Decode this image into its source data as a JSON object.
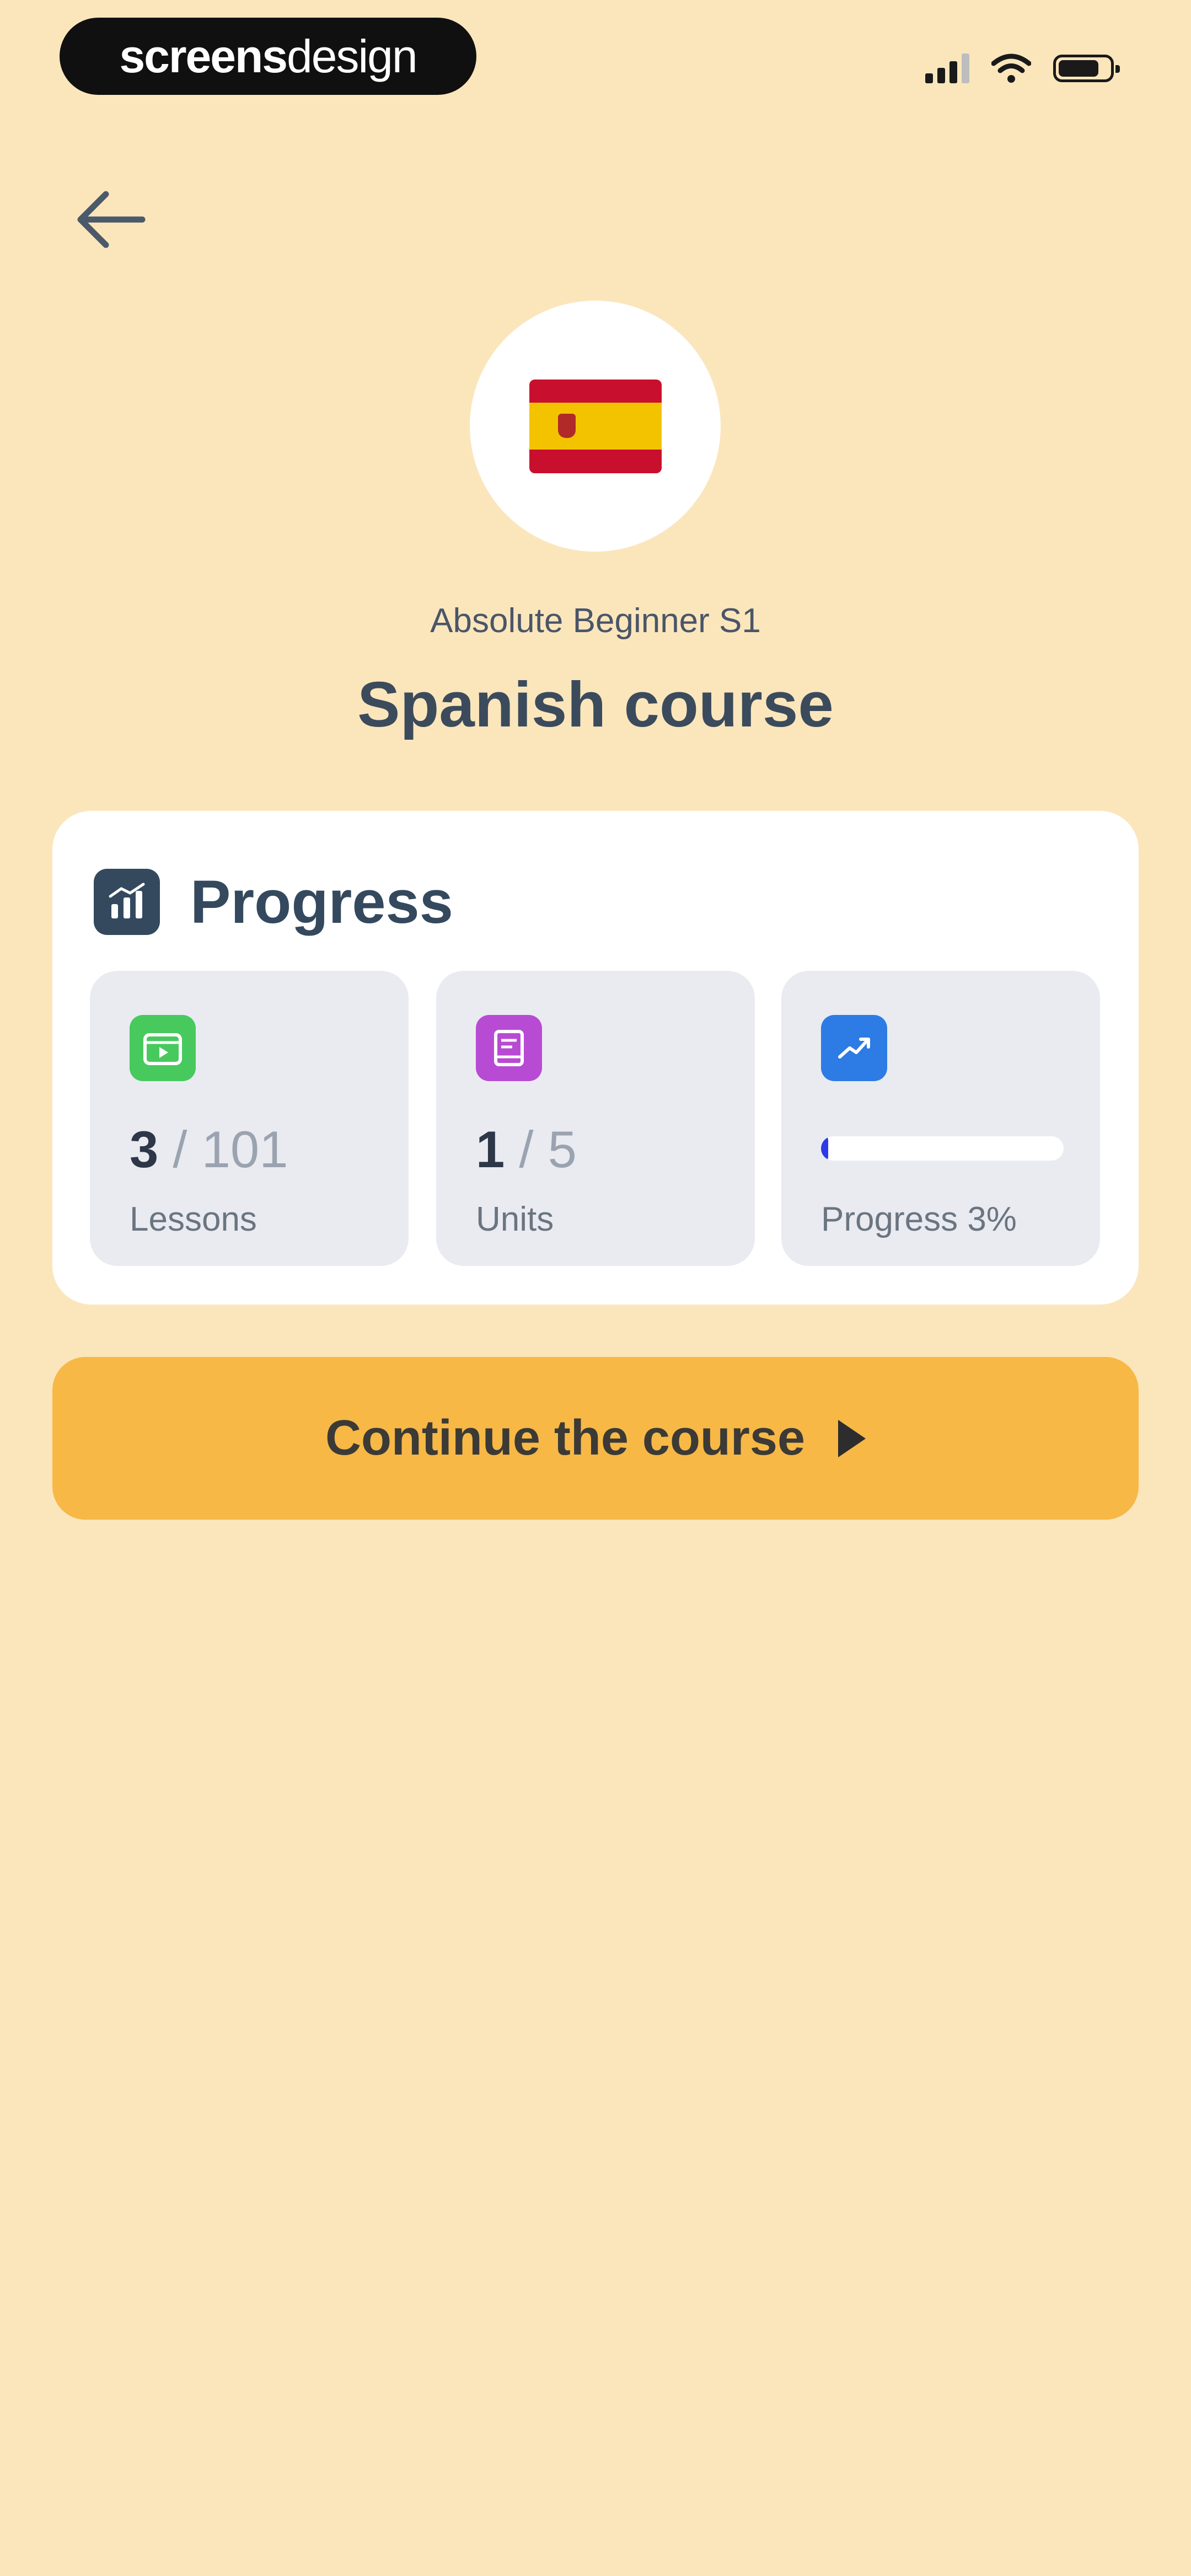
{
  "status_bar": {
    "brand": {
      "part1": "screens",
      "part2": "design"
    },
    "signal_icon": "cellular-signal-icon",
    "wifi_icon": "wifi-icon",
    "battery_icon": "battery-icon"
  },
  "header": {
    "back_icon": "arrow-left-icon"
  },
  "course": {
    "flag_icon": "spain-flag-icon",
    "level": "Absolute Beginner S1",
    "title": "Spanish course"
  },
  "progress_card": {
    "title": "Progress",
    "icon": "chart-icon",
    "stats": {
      "lessons": {
        "current": "3",
        "total": "/ 101",
        "label": "Lessons",
        "icon": "video-lesson-icon"
      },
      "units": {
        "current": "1",
        "total": "/ 5",
        "label": "Units",
        "icon": "book-icon"
      },
      "progress": {
        "label": "Progress 3%",
        "value": 0.03,
        "icon": "trend-up-icon"
      }
    }
  },
  "continue_button": {
    "label": "Continue the course",
    "icon": "play-icon"
  },
  "colors": {
    "background": "#FBE6BC",
    "accent": "#F7B846",
    "lessons_icon": "#48C95E",
    "units_icon": "#B84BD3",
    "progress_icon": "#2D7BE5"
  }
}
